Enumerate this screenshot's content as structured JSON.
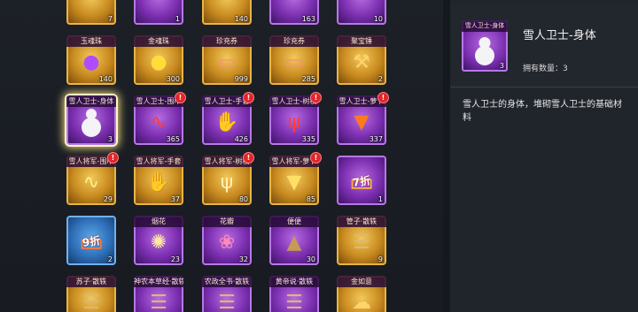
{
  "inventory": {
    "top_row_counts": [
      "7",
      "1",
      "140",
      "163",
      "10"
    ],
    "rows": [
      [
        {
          "label": "玉魂珠",
          "count": "140",
          "rarity": "gold",
          "icon": "purple-soul-orb-icon",
          "alert": false
        },
        {
          "label": "金魂珠",
          "count": "300",
          "rarity": "gold",
          "icon": "gold-soul-orb-icon",
          "alert": false
        },
        {
          "label": "珍充券",
          "count": "999",
          "rarity": "gold",
          "icon": "treasure-voucher-icon",
          "alert": false
        },
        {
          "label": "珍充券",
          "count": "285",
          "rarity": "gold",
          "icon": "treasure-voucher-icon",
          "alert": false
        },
        {
          "label": "聚宝锤",
          "count": "2",
          "rarity": "gold",
          "icon": "treasure-hammer-icon",
          "alert": false
        }
      ],
      [
        {
          "label": "雪人卫士-身体",
          "count": "3",
          "rarity": "purple",
          "icon": "snowman-body-icon",
          "alert": false,
          "selected": true
        },
        {
          "label": "雪人卫士-围巾",
          "count": "365",
          "rarity": "purple",
          "icon": "red-scarf-icon",
          "alert": true
        },
        {
          "label": "雪人卫士-手套",
          "count": "426",
          "rarity": "purple",
          "icon": "red-glove-icon",
          "alert": true
        },
        {
          "label": "雪人卫士-树枝",
          "count": "335",
          "rarity": "purple",
          "icon": "red-branch-icon",
          "alert": true
        },
        {
          "label": "雪人卫士-萝卜",
          "count": "337",
          "rarity": "purple",
          "icon": "carrot-icon",
          "alert": true
        }
      ],
      [
        {
          "label": "雪人将军-围巾",
          "count": "29",
          "rarity": "gold",
          "icon": "gold-scarf-icon",
          "alert": true
        },
        {
          "label": "雪人将军-手套",
          "count": "37",
          "rarity": "gold",
          "icon": "gold-glove-icon",
          "alert": false
        },
        {
          "label": "雪人将军-树枝",
          "count": "80",
          "rarity": "gold",
          "icon": "gold-branch-icon",
          "alert": true
        },
        {
          "label": "雪人将军-萝卜",
          "count": "85",
          "rarity": "gold",
          "icon": "gold-carrot-icon",
          "alert": true
        },
        {
          "label": "",
          "count": "1",
          "rarity": "purple",
          "icon": "discount-7-coupon-icon",
          "alert": false,
          "badge": "7折"
        }
      ],
      [
        {
          "label": "",
          "count": "2",
          "rarity": "blue",
          "icon": "discount-9-coupon-icon",
          "alert": false,
          "badge": "9折"
        },
        {
          "label": "烟花",
          "count": "23",
          "rarity": "purple",
          "icon": "fireworks-icon",
          "alert": false
        },
        {
          "label": "花瓣",
          "count": "32",
          "rarity": "purple",
          "icon": "petals-icon",
          "alert": false
        },
        {
          "label": "便便",
          "count": "30",
          "rarity": "purple",
          "icon": "poop-icon",
          "alert": false
        },
        {
          "label": "管子·散轶",
          "count": "9",
          "rarity": "gold",
          "icon": "bamboo-scroll-icon",
          "alert": false
        }
      ],
      [
        {
          "label": "苏子·散轶",
          "count": "",
          "rarity": "gold",
          "icon": "bamboo-scroll-icon",
          "alert": false
        },
        {
          "label": "神农本草经·散轶",
          "count": "",
          "rarity": "purple",
          "icon": "bamboo-scroll-icon",
          "alert": false
        },
        {
          "label": "农政全书·散轶",
          "count": "",
          "rarity": "purple",
          "icon": "bamboo-scroll-icon",
          "alert": false
        },
        {
          "label": "黄帝说·散轶",
          "count": "",
          "rarity": "purple",
          "icon": "bamboo-scroll-icon",
          "alert": false
        },
        {
          "label": "金如意",
          "count": "",
          "rarity": "gold",
          "icon": "golden-ruyi-icon",
          "alert": false
        }
      ]
    ]
  },
  "detail": {
    "name": "雪人卫士-身体",
    "slot_label": "雪人卫士-身体",
    "slot_count": "3",
    "owned_text": "拥有数量：3",
    "description": "雪人卫士的身体，堆砌雪人卫士的基础材料"
  },
  "colors": {
    "gold": "#e9b543",
    "purple": "#b777e6",
    "blue": "#6fb1ef",
    "alert": "#e0262a"
  }
}
